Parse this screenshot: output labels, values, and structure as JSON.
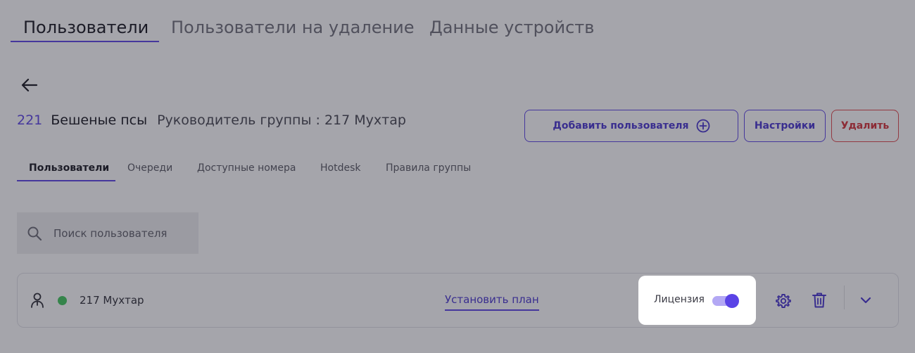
{
  "top_tabs": [
    {
      "label": "Пользователи"
    },
    {
      "label": "Пользователи на удаление"
    },
    {
      "label": "Данные устройств"
    }
  ],
  "group": {
    "number": "221",
    "name": "Бешеные псы",
    "leader_text": "Руководитель группы : 217 Мухтар"
  },
  "actions": {
    "add_user": "Добавить пользователя",
    "settings": "Настройки",
    "delete": "Удалить"
  },
  "sub_tabs": [
    {
      "label": "Пользователи"
    },
    {
      "label": "Очереди"
    },
    {
      "label": "Доступные номера"
    },
    {
      "label": "Hotdesk"
    },
    {
      "label": "Правила группы"
    }
  ],
  "search": {
    "placeholder": "Поиск пользователя",
    "value": ""
  },
  "users": [
    {
      "name": "217 Мухтар",
      "status": "online",
      "plan_link": "Установить план",
      "license_label": "Лицензия",
      "license_enabled": true
    }
  ],
  "colors": {
    "accent": "#5a43e6",
    "danger": "#d42e35",
    "online": "#3ec75a"
  },
  "icons": [
    "back-arrow-icon",
    "plus-circle-icon",
    "search-icon",
    "user-icon",
    "gear-icon",
    "trash-icon",
    "chevron-down-icon"
  ]
}
